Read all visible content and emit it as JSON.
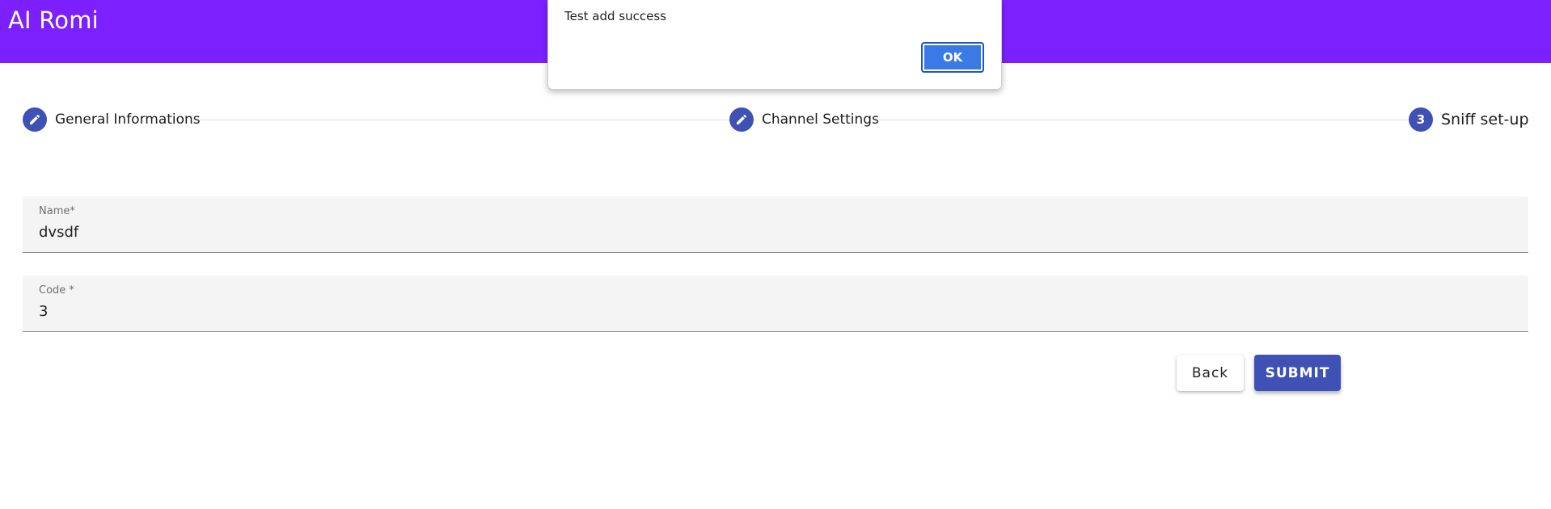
{
  "app": {
    "title": "AI Romi",
    "accent_color": "#7c20ff",
    "primary_color": "#3f51b5"
  },
  "stepper": {
    "steps": [
      {
        "label": "General Informations",
        "icon": "pencil-icon",
        "state": "completed"
      },
      {
        "label": "Channel Settings",
        "icon": "pencil-icon",
        "state": "completed"
      },
      {
        "label": "Sniff set-up",
        "number": "3",
        "state": "active"
      }
    ]
  },
  "form": {
    "name": {
      "label": "Name*",
      "value": "dvsdf"
    },
    "code": {
      "label": "Code *",
      "value": "3"
    }
  },
  "actions": {
    "back_label": "Back",
    "submit_label": "SUBMIT"
  },
  "dialog": {
    "message": "Test add success",
    "ok_label": "OK"
  }
}
